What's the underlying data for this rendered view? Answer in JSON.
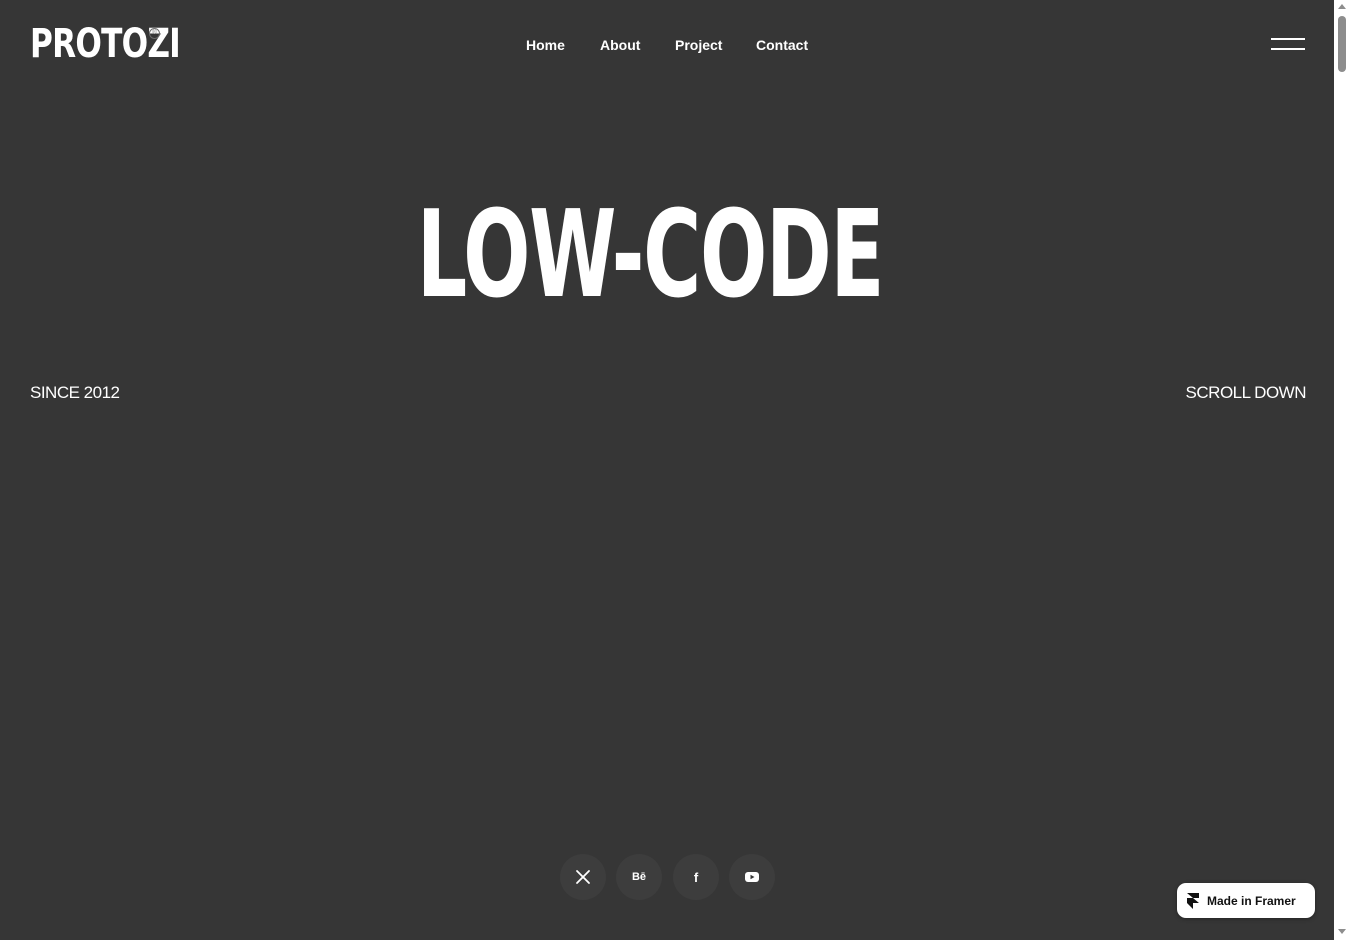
{
  "header": {
    "logo": "PROTOZI",
    "logo_mark": "®",
    "nav": [
      "Home",
      "About",
      "Project",
      "Contact"
    ],
    "menu_icon": "hamburger-menu-icon"
  },
  "hero": {
    "title": "LOW-CODE",
    "since": "SINCE 2012",
    "scroll": "SCROLL DOWN"
  },
  "socials": [
    {
      "name": "x-icon",
      "glyph": "✕"
    },
    {
      "name": "behance-icon",
      "glyph": "Bē"
    },
    {
      "name": "facebook-icon",
      "glyph": "f"
    },
    {
      "name": "youtube-icon",
      "glyph": "▶"
    }
  ],
  "badge": {
    "label": "Made in Framer",
    "icon": "framer-logo-icon"
  },
  "colors": {
    "background": "#363636",
    "text": "#ffffff",
    "social_bg": "#3d3d3d",
    "badge_bg": "#ffffff"
  }
}
